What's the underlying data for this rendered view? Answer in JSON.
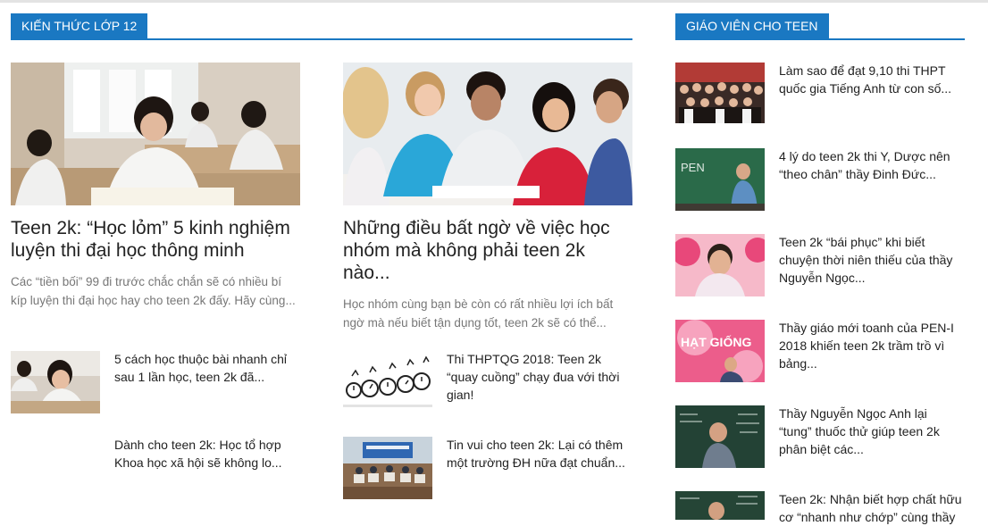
{
  "left_section": {
    "header": "KIẾN THỨC LỚP 12",
    "featured": [
      {
        "title": "Teen 2k: “Học lỏm” 5 kinh nghiệm luyện thi đại học thông minh",
        "excerpt": "Các “tiền bối” 99 đi trước chắc chắn sẽ có nhiều bí kíp luyện thi đại học hay cho teen 2k đấy. Hãy cùng..."
      },
      {
        "title": "Những điều bất ngờ về việc học nhóm mà không phải teen 2k nào...",
        "excerpt": "Học nhóm cùng bạn bè còn có rất nhiều lợi ích bất ngờ mà nếu biết tận dụng tốt, teen 2k sẽ có thể..."
      }
    ],
    "list_col1": [
      {
        "title": "5 cách học thuộc bài nhanh chỉ sau 1 lần học,  teen 2k đã..."
      },
      {
        "title": "Dành cho teen 2k: Học tổ hợp Khoa học xã hội sẽ không lo..."
      }
    ],
    "list_col2": [
      {
        "title": "Thi THPTQG 2018: Teen 2k “quay cuồng” chạy đua với thời gian!"
      },
      {
        "title": "Tin vui cho teen 2k: Lại có thêm một trường ĐH nữa đạt chuẩn..."
      }
    ]
  },
  "right_section": {
    "header": "GIÁO VIÊN CHO TEEN",
    "items": [
      {
        "title": "Làm sao để đạt 9,10 thi THPT quốc gia Tiếng Anh từ con số..."
      },
      {
        "title": "4 lý do teen 2k thi Y, Dược nên “theo chân” thầy Đinh Đức..."
      },
      {
        "title": "Teen 2k “bái phục” khi biết chuyện thời niên thiếu của thầy Nguyễn Ngọc..."
      },
      {
        "title": "Thầy giáo mới toanh của PEN-I 2018 khiến teen 2k trầm trồ vì bảng..."
      },
      {
        "title": "Thầy Nguyễn Ngọc Anh lại “tung” thuốc thử giúp teen 2k phân biệt các..."
      },
      {
        "title": "Teen 2k: Nhận biết hợp chất hữu cơ “nhanh như chớp” cùng thầy"
      }
    ],
    "thumb_text": {
      "pen": "PEN",
      "hat_giong": "HẠT GIỐNG"
    }
  },
  "colors": {
    "accent": "#1a78c2",
    "excerpt": "#777777",
    "title": "#222222"
  }
}
